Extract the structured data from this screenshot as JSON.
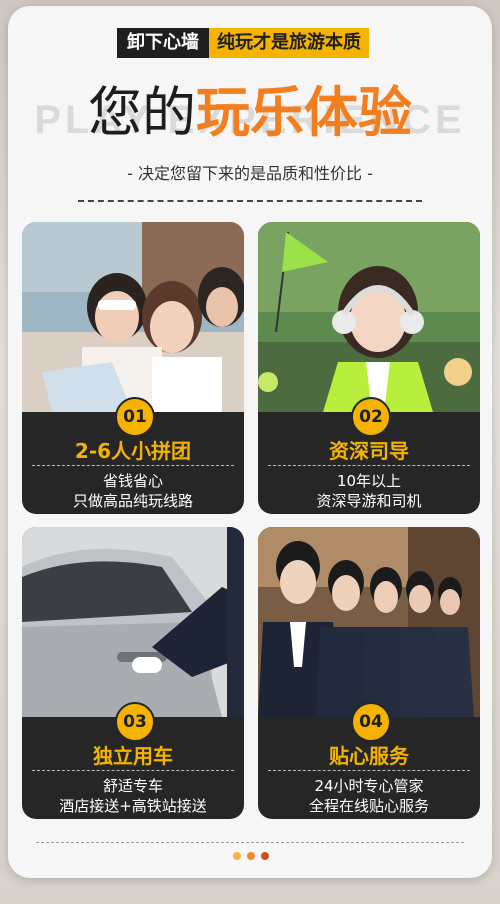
{
  "header": {
    "tag_left": "卸下心墙",
    "tag_right": "纯玩才是旅游本质",
    "bg_word": "PLAY EXPERIENCE",
    "title_dark": "您的",
    "title_highlight": "玩乐体验",
    "subtitle": "- 决定您留下来的是品质和性价比 -"
  },
  "colors": {
    "accent": "#f3b300",
    "highlight": "#f37e1f",
    "tile_bg": "#262626"
  },
  "tiles": [
    {
      "number": "01",
      "title": "2-6人小拼团",
      "line1": "省钱省心",
      "line2": "只做高品纯玩线路",
      "photo": "group-tourists-photo"
    },
    {
      "number": "02",
      "title": "资深司导",
      "line1": "10年以上",
      "line2": "资深导游和司机",
      "photo": "tour-guide-photo"
    },
    {
      "number": "03",
      "title": "独立用车",
      "line1": "舒适专车",
      "line2": "酒店接送+高铁站接送",
      "photo": "private-car-photo"
    },
    {
      "number": "04",
      "title": "贴心服务",
      "line1": "24小时专心管家",
      "line2": "全程在线贴心服务",
      "photo": "service-staff-photo"
    }
  ],
  "pager": {
    "dot_colors": [
      "#f5b340",
      "#f08a2a",
      "#c94f1e"
    ]
  }
}
